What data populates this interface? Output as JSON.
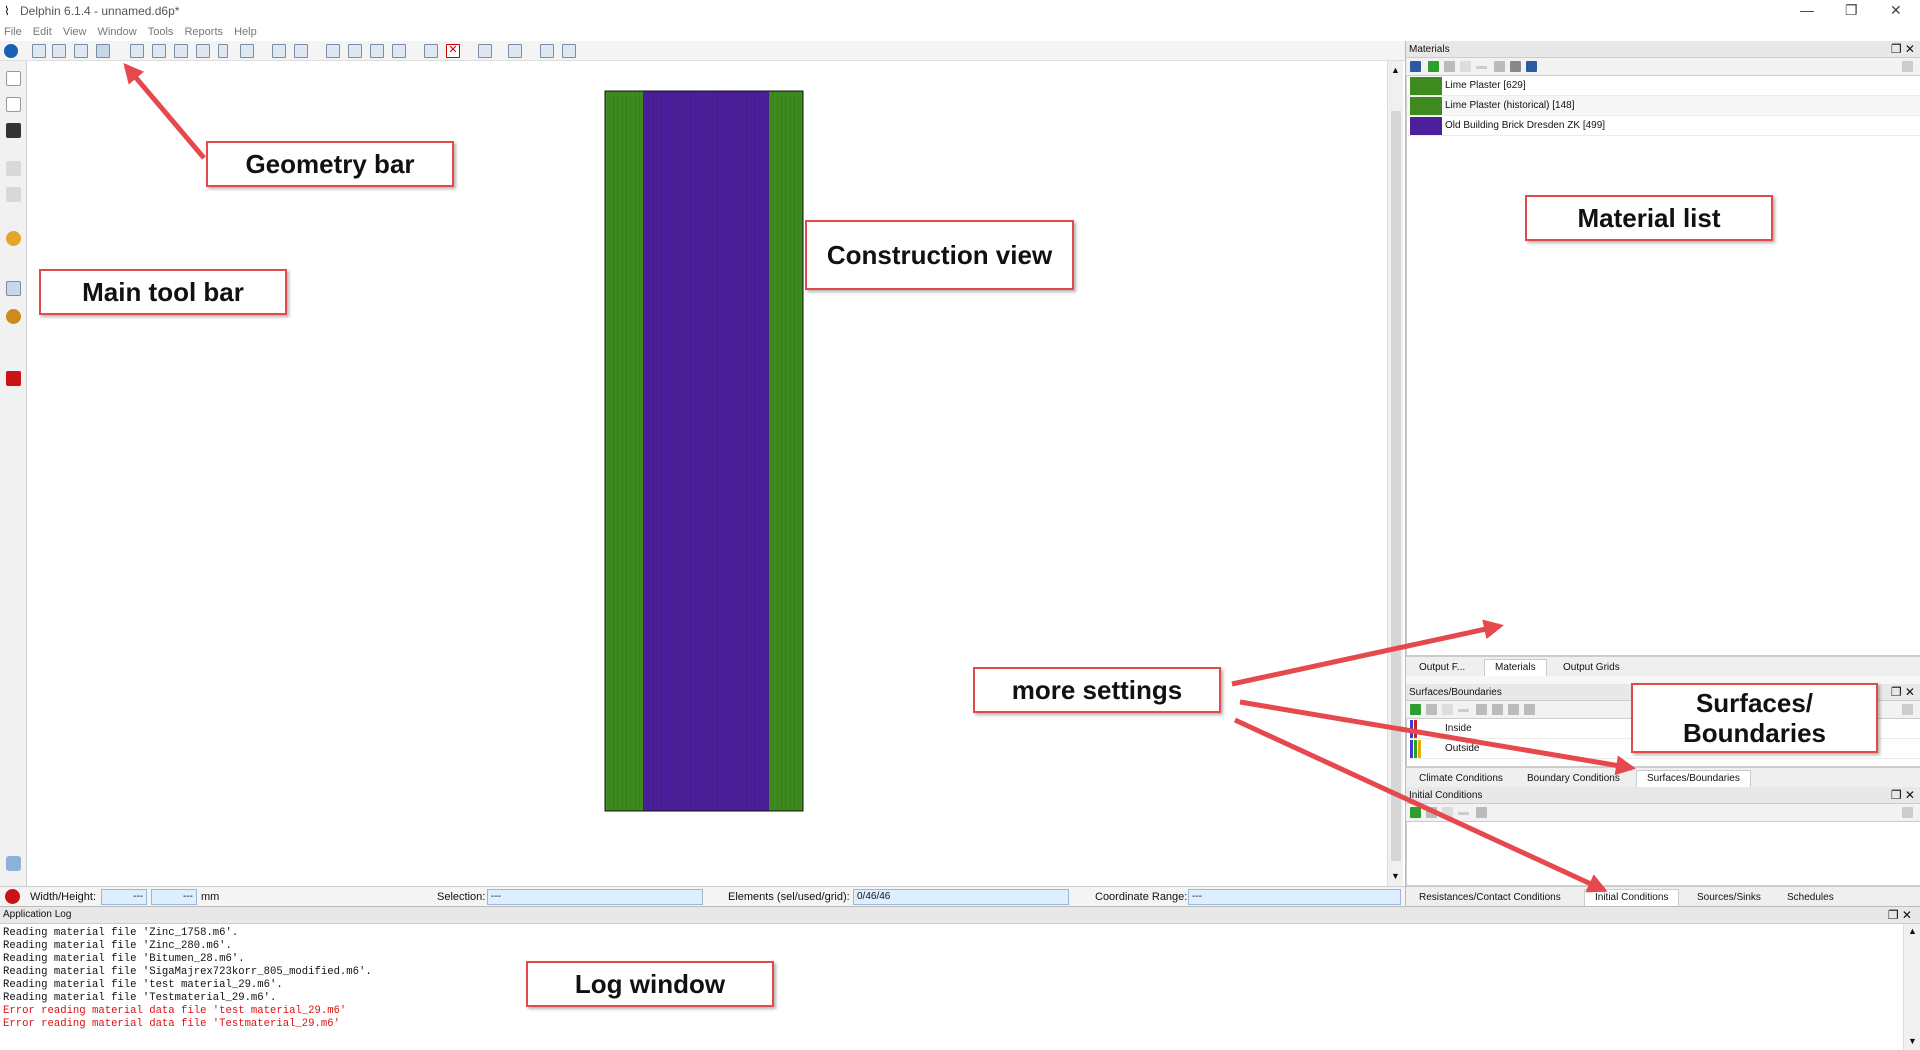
{
  "window": {
    "title": "Delphin 6.1.4 - unnamed.d6p*",
    "controls": [
      "—",
      "❐",
      "✕"
    ]
  },
  "menu": [
    "File",
    "Edit",
    "View",
    "Window",
    "Tools",
    "Reports",
    "Help"
  ],
  "statusbar": {
    "width_height_label": "Width/Height:",
    "width_value": "---",
    "height_value": "---",
    "unit": "mm",
    "selection_label": "Selection:",
    "selection_value": "---",
    "elements_label": "Elements (sel/used/grid):",
    "elements_value": "0/46/46",
    "coord_label": "Coordinate Range:",
    "coord_value": "---"
  },
  "materials": {
    "title": "Materials",
    "items": [
      {
        "name": "Lime Plaster [629]",
        "color": "#3d8b1f"
      },
      {
        "name": "Lime Plaster (historical) [148]",
        "color": "#3d8b1f"
      },
      {
        "name": "Old Building Brick Dresden ZK [499]",
        "color": "#4b1f9a"
      }
    ],
    "tabs": [
      "Output F...",
      "Materials",
      "Output Grids"
    ]
  },
  "surfaces": {
    "title": "Surfaces/Boundaries",
    "items": [
      "Inside",
      "Outside"
    ],
    "tabs": [
      "Climate Conditions",
      "Boundary Conditions",
      "Surfaces/Boundaries"
    ]
  },
  "initial": {
    "title": "Initial Conditions",
    "tabs": [
      "Resistances/Contact Conditions",
      "Initial Conditions",
      "Sources/Sinks",
      "Schedules"
    ]
  },
  "log": {
    "title": "Application Log",
    "lines": [
      {
        "text": "Reading material file 'Zinc_1758.m6'.",
        "error": false
      },
      {
        "text": "Reading material file 'Zinc_280.m6'.",
        "error": false
      },
      {
        "text": "Reading material file 'Bitumen_28.m6'.",
        "error": false
      },
      {
        "text": "Reading material file 'SigaMajrex723korr_805_modified.m6'.",
        "error": false
      },
      {
        "text": "Reading material file 'test material_29.m6'.",
        "error": false
      },
      {
        "text": "Reading material file 'Testmaterial_29.m6'.",
        "error": false
      },
      {
        "text": "Error reading material data file 'test material_29.m6'",
        "error": true
      },
      {
        "text": "Error reading material data file 'Testmaterial_29.m6'",
        "error": true
      }
    ]
  },
  "construction": {
    "colors": {
      "plaster": "#3d8b1f",
      "brick": "#4b1f9a"
    }
  },
  "callouts": {
    "geometry_bar": "Geometry bar",
    "main_tool_bar": "Main tool bar",
    "construction_view": "Construction view",
    "material_list": "Material list",
    "more_settings": "more settings",
    "surfaces_boundaries": "Surfaces/ Boundaries",
    "log_window": "Log window"
  },
  "accent_color": "#e5484d"
}
